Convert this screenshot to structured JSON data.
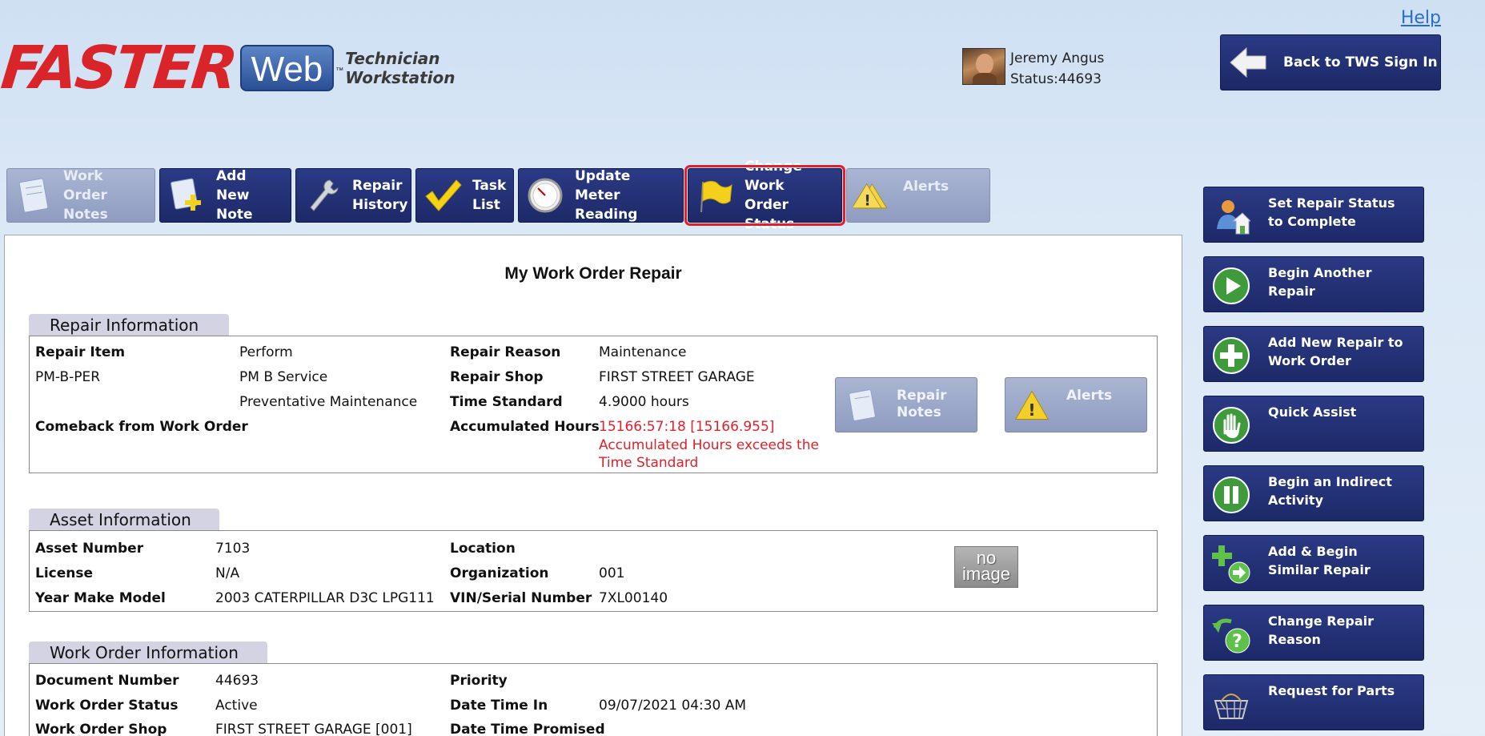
{
  "header": {
    "help": "Help",
    "logo_faster": "FASTER",
    "logo_web": "Web",
    "logo_tm": "™",
    "logo_tw_line1": "Technician",
    "logo_tw_line2": "Workstation",
    "user_name": "Jeremy Angus",
    "user_status": "Status:44693",
    "back_button": "Back to TWS Sign In"
  },
  "tabs": [
    {
      "line1": "Work Order",
      "line2": "Notes",
      "icon": "notepad-icon",
      "state": "disabled"
    },
    {
      "line1": "Add New",
      "line2": "Note",
      "icon": "add-note-icon",
      "state": "normal"
    },
    {
      "line1": "Repair",
      "line2": "History",
      "icon": "wrench-icon",
      "state": "normal"
    },
    {
      "line1": "Task",
      "line2": "List",
      "icon": "checkmark-icon",
      "state": "normal"
    },
    {
      "line1": "Update Meter",
      "line2": "Reading",
      "icon": "gauge-icon",
      "state": "normal"
    },
    {
      "line1": "Change Work",
      "line2": "Order Status",
      "icon": "flag-icon",
      "state": "selected"
    },
    {
      "line1": "Alerts",
      "line2": "",
      "icon": "warning-stack-icon",
      "state": "disabled"
    }
  ],
  "main": {
    "title": "My Work Order Repair",
    "repair": {
      "section": "Repair Information",
      "repair_item_label": "Repair Item",
      "repair_item_code": "PM-B-PER",
      "desc1": "Perform",
      "desc2": "PM B Service",
      "desc3": "Preventative Maintenance",
      "comeback_label": "Comeback from Work Order",
      "reason_label": "Repair Reason",
      "reason_value": "Maintenance",
      "shop_label": "Repair Shop",
      "shop_value": "FIRST STREET GARAGE",
      "time_std_label": "Time Standard",
      "time_std_value": "4.9000 hours",
      "acc_label": "Accumulated Hours",
      "acc_value": "15166:57:18 [15166.955]",
      "acc_warn1": "Accumulated Hours exceeds the",
      "acc_warn2": "Time Standard",
      "btn_notes_line1": "Repair",
      "btn_notes_line2": "Notes",
      "btn_alerts": "Alerts"
    },
    "asset": {
      "section": "Asset Information",
      "asset_number_label": "Asset Number",
      "asset_number": "7103",
      "license_label": "License",
      "license": "N/A",
      "ymm_label": "Year Make Model",
      "ymm": "2003 CATERPILLAR D3C LPG111",
      "location_label": "Location",
      "location": "",
      "org_label": "Organization",
      "org": "001",
      "vin_label": "VIN/Serial Number",
      "vin": "7XL00140",
      "no_image_line1": "no",
      "no_image_line2": "image"
    },
    "workorder": {
      "section": "Work Order Information",
      "doc_label": "Document Number",
      "doc": "44693",
      "status_label": "Work Order Status",
      "status": "Active",
      "shop_label": "Work Order Shop",
      "shop": "FIRST STREET GARAGE [001]",
      "priority_label": "Priority",
      "priority": "",
      "dt_in_label": "Date Time In",
      "dt_in": "09/07/2021 04:30 AM",
      "dt_promised_label": "Date Time Promised",
      "dt_promised": ""
    }
  },
  "sidebar": [
    {
      "line1": "Set Repair Status",
      "line2": "to Complete",
      "icon": "person-house-icon"
    },
    {
      "line1": "Begin Another",
      "line2": "Repair",
      "icon": "play-icon"
    },
    {
      "line1": "Add New Repair to",
      "line2": "Work Order",
      "icon": "plus-circle-icon"
    },
    {
      "line1": "Quick Assist",
      "line2": "",
      "icon": "hand-icon"
    },
    {
      "line1": "Begin an Indirect",
      "line2": "Activity",
      "icon": "pause-icon"
    },
    {
      "line1": "Add & Begin",
      "line2": "Similar Repair",
      "icon": "plus-arrow-icon"
    },
    {
      "line1": "Change Repair",
      "line2": "Reason",
      "icon": "question-arrow-icon"
    },
    {
      "line1": "Request for Parts",
      "line2": "",
      "icon": "basket-icon"
    }
  ]
}
